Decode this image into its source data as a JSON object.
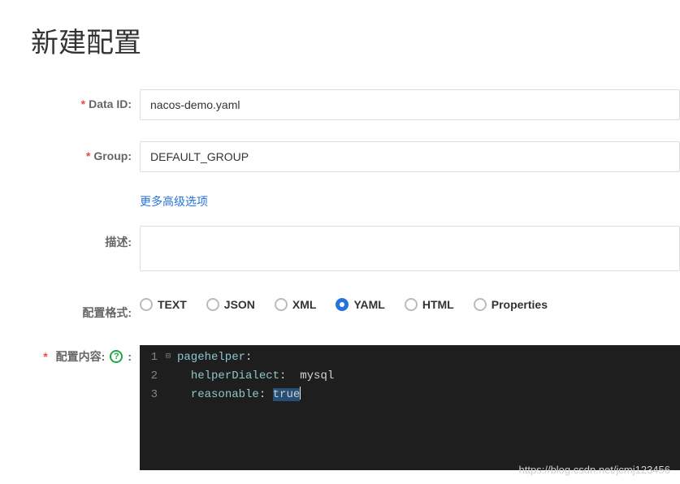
{
  "page": {
    "title": "新建配置"
  },
  "form": {
    "data_id": {
      "label": "Data ID:",
      "value": "nacos-demo.yaml"
    },
    "group": {
      "label": "Group:",
      "value": "DEFAULT_GROUP"
    },
    "advanced_link": "更多高级选项",
    "description": {
      "label": "描述:",
      "value": ""
    },
    "format": {
      "label": "配置格式:",
      "options": [
        "TEXT",
        "JSON",
        "XML",
        "YAML",
        "HTML",
        "Properties"
      ],
      "selected": "YAML"
    },
    "content": {
      "label": "配置内容:",
      "help_icon": "?",
      "colon": ":",
      "lines": [
        {
          "n": "1",
          "fold": "⊟",
          "segments": [
            {
              "t": "pagehelper",
              "c": "key"
            },
            {
              "t": ":",
              "c": "plain"
            }
          ]
        },
        {
          "n": "2",
          "fold": "",
          "segments": [
            {
              "t": "  ",
              "c": "plain"
            },
            {
              "t": "helperDialect",
              "c": "key"
            },
            {
              "t": ":  ",
              "c": "plain"
            },
            {
              "t": "mysql",
              "c": "val"
            }
          ]
        },
        {
          "n": "3",
          "fold": "",
          "segments": [
            {
              "t": "  ",
              "c": "plain"
            },
            {
              "t": "reasonable",
              "c": "key"
            },
            {
              "t": ": ",
              "c": "plain"
            },
            {
              "t": "true",
              "c": "sel"
            }
          ],
          "cursor": true
        }
      ]
    }
  },
  "watermark": "https://blog.csdn.net/jcmj123456"
}
